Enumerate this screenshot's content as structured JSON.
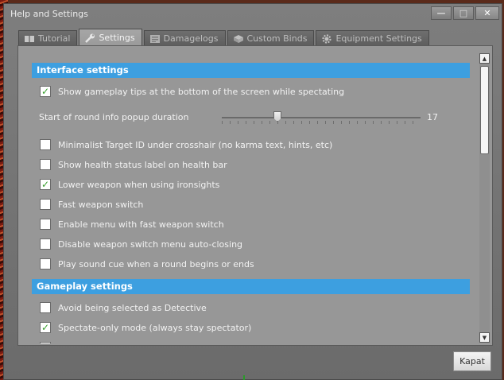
{
  "window": {
    "title": "Help and Settings",
    "controls": {
      "minimize": "—",
      "maximize": "□",
      "close": "✕"
    }
  },
  "tabs": [
    {
      "label": "Tutorial",
      "icon": "book-icon",
      "active": false
    },
    {
      "label": "Settings",
      "icon": "wrench-icon",
      "active": true
    },
    {
      "label": "Damagelogs",
      "icon": "log-icon",
      "active": false
    },
    {
      "label": "Custom Binds",
      "icon": "box-icon",
      "active": false
    },
    {
      "label": "Equipment Settings",
      "icon": "gear-icon",
      "active": false
    }
  ],
  "sections": {
    "interface": "Interface settings",
    "gameplay": "Gameplay settings"
  },
  "options": {
    "gameplay_tips": {
      "label": "Show gameplay tips at the bottom of the screen while spectating",
      "checked": true
    },
    "popup_duration": {
      "label": "Start of round info popup duration",
      "value": "17",
      "fraction": 0.28
    },
    "minimalist_target": {
      "label": "Minimalist Target ID under crosshair (no karma text, hints, etc)",
      "checked": false
    },
    "health_label": {
      "label": "Show health status label on health bar",
      "checked": false
    },
    "lower_weapon": {
      "label": "Lower weapon when using ironsights",
      "checked": true
    },
    "fast_switch": {
      "label": "Fast weapon switch",
      "checked": false
    },
    "menu_fast_switch": {
      "label": "Enable menu with fast weapon switch",
      "checked": false
    },
    "disable_autoclose": {
      "label": "Disable weapon switch menu auto-closing",
      "checked": false
    },
    "sound_cue": {
      "label": "Play sound cue when a round begins or ends",
      "checked": false
    },
    "avoid_detective": {
      "label": "Avoid being selected as Detective",
      "checked": false
    },
    "spectate_only": {
      "label": "Spectate-only mode (always stay spectator)",
      "checked": true
    }
  },
  "buttons": {
    "close": "Kapat"
  },
  "colors": {
    "section_header": "#3d9fe0",
    "check": "#3aa030",
    "panel": "#979797"
  }
}
